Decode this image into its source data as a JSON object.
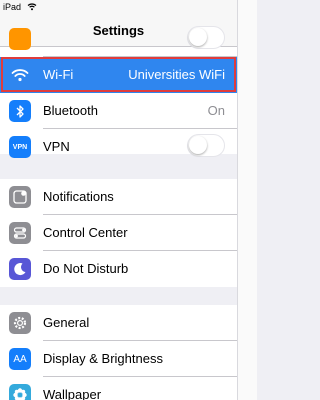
{
  "status_bar": {
    "carrier": "iPad"
  },
  "nav": {
    "title": "Settings"
  },
  "rows": {
    "wifi": {
      "label": "Wi-Fi",
      "value": "Universities WiFi",
      "icon": "wifi-icon",
      "selected": true,
      "color": "#2f86ef"
    },
    "bluetooth": {
      "label": "Bluetooth",
      "value": "On",
      "icon": "bluetooth-icon",
      "color": "#147efb"
    },
    "vpn": {
      "label": "VPN",
      "icon": "vpn-icon",
      "icon_text": "VPN",
      "toggle": "off",
      "color": "#147efb"
    },
    "notifications": {
      "label": "Notifications",
      "icon": "notifications-icon",
      "color": "#8e8e93"
    },
    "control_center": {
      "label": "Control Center",
      "icon": "control-center-icon",
      "color": "#8e8e93"
    },
    "do_not_disturb": {
      "label": "Do Not Disturb",
      "icon": "moon-icon",
      "color": "#5856d6"
    },
    "general": {
      "label": "General",
      "icon": "gear-icon",
      "color": "#8e8e93"
    },
    "display": {
      "label": "Display & Brightness",
      "icon": "display-brightness-icon",
      "icon_text": "AA",
      "color": "#147efb"
    },
    "wallpaper": {
      "label": "Wallpaper",
      "icon": "wallpaper-icon",
      "color": "#34aadc"
    }
  },
  "colors": {
    "selection": "#2f86ef",
    "highlight_border": "#e03c3c",
    "background": "#efeff4"
  }
}
